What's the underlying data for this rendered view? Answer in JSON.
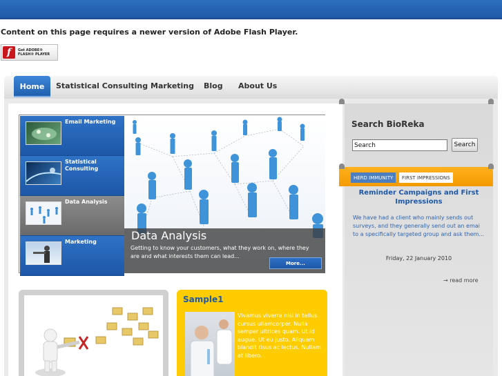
{
  "flash": {
    "message": "Content on this page requires a newer version of Adobe Flash Player.",
    "badge_line1": "Get ADOBE®",
    "badge_line2": "FLASH® PLAYER",
    "badge_letter": "f"
  },
  "nav": {
    "items": [
      "Home",
      "Statistical Consulting",
      "Marketing",
      "Blog",
      "About Us"
    ]
  },
  "slider": {
    "items": [
      "Email Marketing",
      "Statistical Consulting",
      "Data Analysis",
      "Marketing"
    ],
    "active_index": 2,
    "caption_title": "Data Analysis",
    "caption_text": "Getting to know your customers, what they work on, where they are and what interests them can lead...",
    "more_label": "More..."
  },
  "sample": {
    "title": "Sample1",
    "text": "Vivamus viverra nisi in tellus cursus ullamcorper. Nulla semper ultrices quam. Ut id augue. Ut eu justo. Aliquam blandit risus ac lectus. Nullam at libero."
  },
  "sidebar": {
    "title": "Search BioReka",
    "search_value": "Search",
    "search_button": "Search",
    "tabs": [
      "HERD IMMUNITY",
      "FIRST IMPRESSIONS"
    ],
    "news_title": "Reminder Campaigns and First Impressions",
    "news_text": "We have had a client who mainly sends out surveys, and they generally send out an emai to a specifically targeted group and ask them...",
    "news_date": "Friday, 22 January 2010",
    "read_more": "→ read more"
  },
  "colors": {
    "brand_blue": "#1d57a8",
    "ribbon_orange": "#f39a00",
    "sample_yellow": "#ffcc00"
  }
}
